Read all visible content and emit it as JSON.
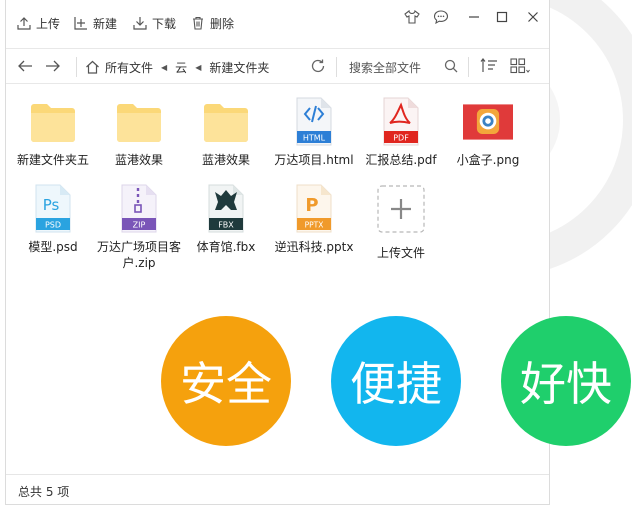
{
  "toolbar": {
    "upload_label": "上传",
    "new_label": "新建",
    "download_label": "下载",
    "delete_label": "删除"
  },
  "breadcrumb": {
    "items": [
      "所有文件",
      "云",
      "新建文件夹"
    ]
  },
  "search": {
    "placeholder": "搜索全部文件"
  },
  "files": [
    {
      "name": "新建文件夹五",
      "icon": "folder-icon"
    },
    {
      "name": "蓝港效果",
      "icon": "folder-icon"
    },
    {
      "name": "蓝港效果",
      "icon": "folder-icon"
    },
    {
      "name": "万达项目.html",
      "icon": "html-file-icon",
      "badge": "HTML"
    },
    {
      "name": "汇报总结.pdf",
      "icon": "pdf-file-icon",
      "badge": "PDF"
    },
    {
      "name": "小盒子.png",
      "icon": "image-thumbnail-icon"
    },
    {
      "name": "模型.psd",
      "icon": "psd-file-icon",
      "badge": "PSD",
      "glyph": "Ps"
    },
    {
      "name": "万达广场项目客户.zip",
      "icon": "zip-file-icon",
      "badge": "ZIP"
    },
    {
      "name": "体育馆.fbx",
      "icon": "fbx-file-icon",
      "badge": "FBX"
    },
    {
      "name": "逆迅科技.pptx",
      "icon": "pptx-file-icon",
      "badge": "PPTX",
      "glyph": "P"
    },
    {
      "name": "上传文件",
      "icon": "upload-plus-icon"
    }
  ],
  "status": {
    "count_text": "总共 5 项"
  },
  "promo": [
    {
      "text": "安全",
      "color": "#f5a10d"
    },
    {
      "text": "便捷",
      "color": "#12b6ee"
    },
    {
      "text": "好快",
      "color": "#1fcf6c"
    }
  ],
  "colors": {
    "folder": "#fbd878",
    "html": "#2d7fd6",
    "pdf": "#e0261f",
    "psd": "#2aa3e0",
    "zip": "#7a55b8",
    "fbx": "#1f3a3c",
    "pptx": "#f09a2b"
  }
}
